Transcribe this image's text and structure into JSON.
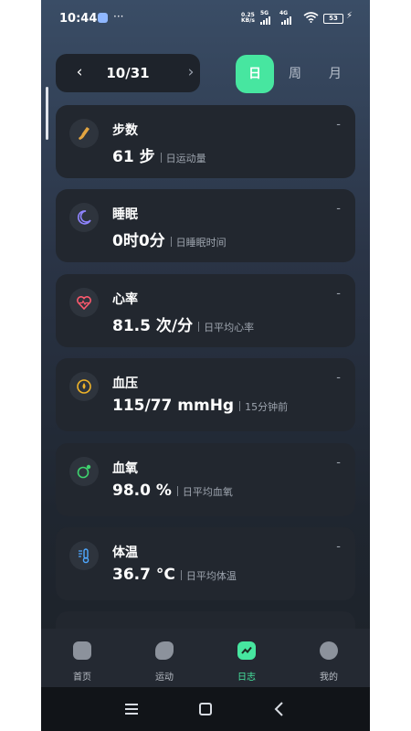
{
  "status_bar": {
    "time": "10:44",
    "more": "···",
    "net_speed_top": "0.25",
    "net_speed_unit": "KB/s",
    "net_5g": "5G",
    "net_4g": "4G",
    "battery": "53"
  },
  "date_nav": {
    "prev": "‹",
    "date": "10/31",
    "next": "›"
  },
  "period_tabs": {
    "day": "日",
    "week": "周",
    "month": "月",
    "selected": "日"
  },
  "cards": [
    {
      "title": "步数",
      "value": "61 步",
      "note": "日运动量",
      "dash": "-",
      "icon": "shoe-icon",
      "color": "#e3a541"
    },
    {
      "title": "睡眠",
      "value": "0时0分",
      "note": "日睡眠时间",
      "dash": "-",
      "icon": "moon-icon",
      "color": "#8f84ff"
    },
    {
      "title": "心率",
      "value": "81.5 次/分",
      "note": "日平均心率",
      "dash": "-",
      "icon": "heart-icon",
      "color": "#ff5a6e"
    },
    {
      "title": "血压",
      "value": "115/77 mmHg",
      "note": "15分钟前",
      "dash": "-",
      "icon": "blood-drop-icon",
      "color": "#f0b429"
    },
    {
      "title": "血氧",
      "value": "98.0 %",
      "note": "日平均血氧",
      "dash": "-",
      "icon": "oxygen-icon",
      "color": "#3ed36e"
    },
    {
      "title": "体温",
      "value": "36.7 °C",
      "note": "日平均体温",
      "dash": "-",
      "icon": "thermometer-icon",
      "color": "#4fa8ff"
    }
  ],
  "bottom_nav": {
    "items": [
      {
        "label": "首页",
        "icon": "home-icon"
      },
      {
        "label": "运动",
        "icon": "sport-icon"
      },
      {
        "label": "日志",
        "icon": "log-chart-icon"
      },
      {
        "label": "我的",
        "icon": "profile-icon"
      }
    ],
    "active": "日志"
  },
  "system_nav": {
    "menu": "☰",
    "home": "□",
    "back": "‹"
  },
  "colors": {
    "accent": "#47e6a0",
    "card_bg": "#22272f",
    "text_secondary": "#9da4ae"
  }
}
